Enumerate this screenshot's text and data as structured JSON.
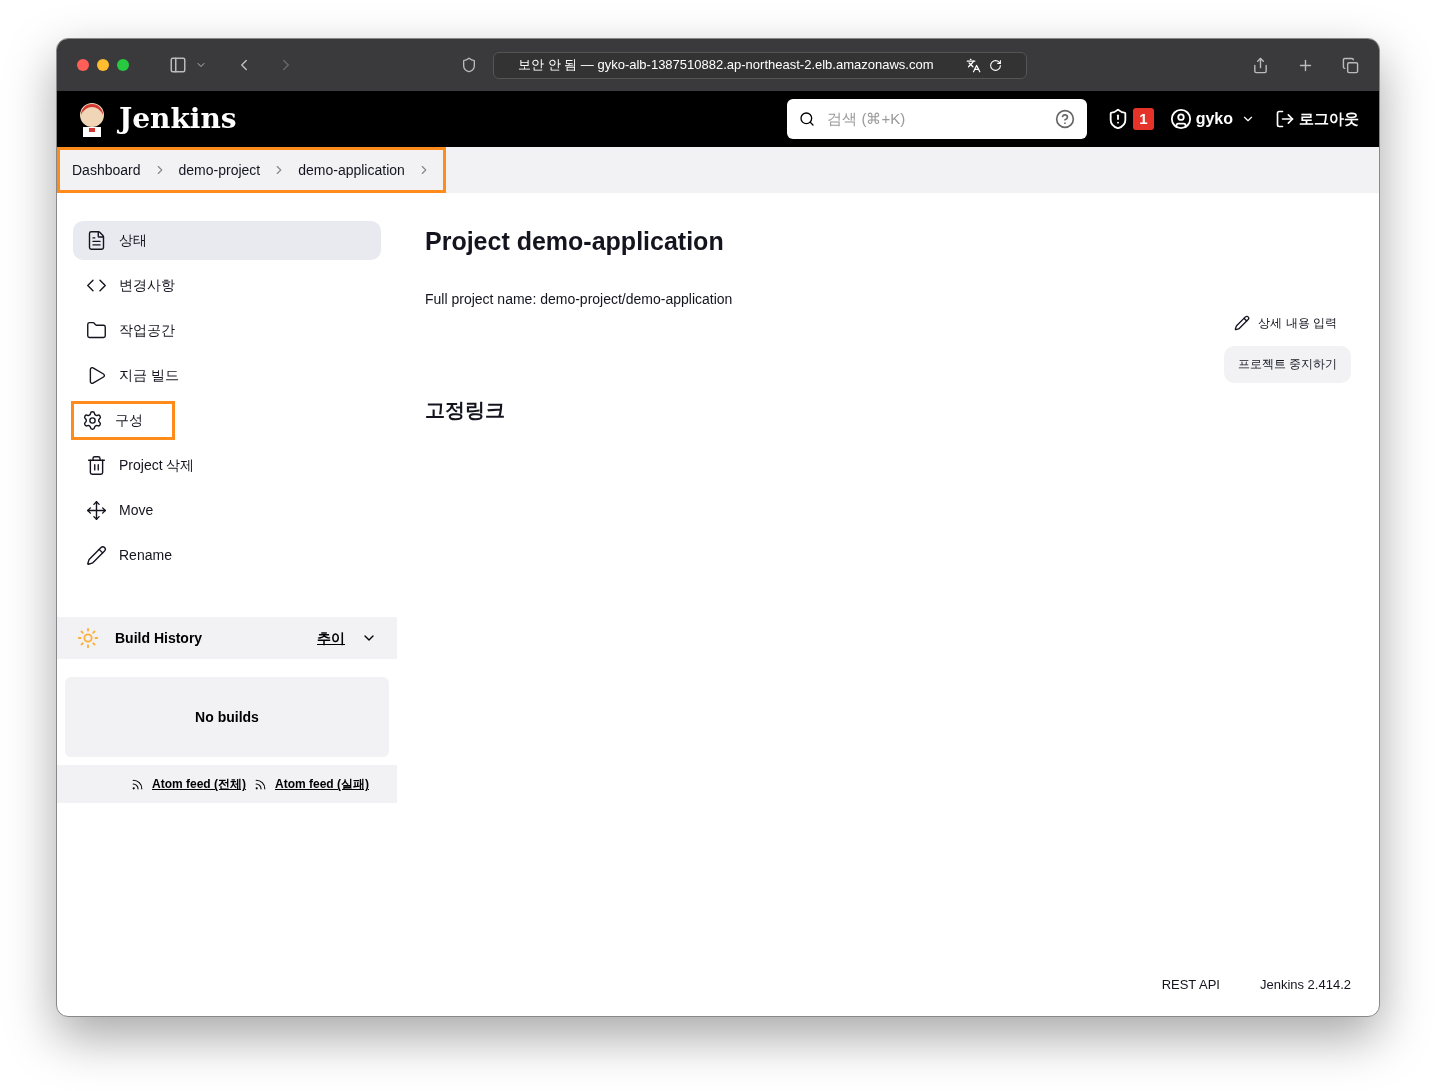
{
  "browser": {
    "address": "보안 안 됨 — gyko-alb-1387510882.ap-northeast-2.elb.amazonaws.com"
  },
  "header": {
    "brand": "Jenkins",
    "search": {
      "placeholder": "검색 (⌘+K)"
    },
    "alert_count": "1",
    "user": "gyko",
    "logout": "로그아웃"
  },
  "breadcrumbs": {
    "highlighted": true,
    "items": [
      "Dashboard",
      "demo-project",
      "demo-application"
    ]
  },
  "sidebar": {
    "items": [
      {
        "label": "상태",
        "selected": true,
        "highlighted": false
      },
      {
        "label": "변경사항",
        "selected": false,
        "highlighted": false
      },
      {
        "label": "작업공간",
        "selected": false,
        "highlighted": false
      },
      {
        "label": "지금 빌드",
        "selected": false,
        "highlighted": false
      },
      {
        "label": "구성",
        "selected": false,
        "highlighted": true
      },
      {
        "label": "Project 삭제",
        "selected": false,
        "highlighted": false
      },
      {
        "label": "Move",
        "selected": false,
        "highlighted": false
      },
      {
        "label": "Rename",
        "selected": false,
        "highlighted": false
      }
    ]
  },
  "build_history": {
    "title": "Build History",
    "trend": "추이",
    "empty": "No builds",
    "feeds": [
      "Atom feed (전체)",
      "Atom feed (실패)"
    ]
  },
  "main": {
    "title": "Project demo-application",
    "full_name": "Full project name: demo-project/demo-application",
    "edit_description": "상세 내용 입력",
    "disable_button": "프로젝트 중지하기",
    "permalinks_title": "고정링크"
  },
  "footer": {
    "links": [
      "REST API",
      "Jenkins 2.414.2"
    ]
  }
}
